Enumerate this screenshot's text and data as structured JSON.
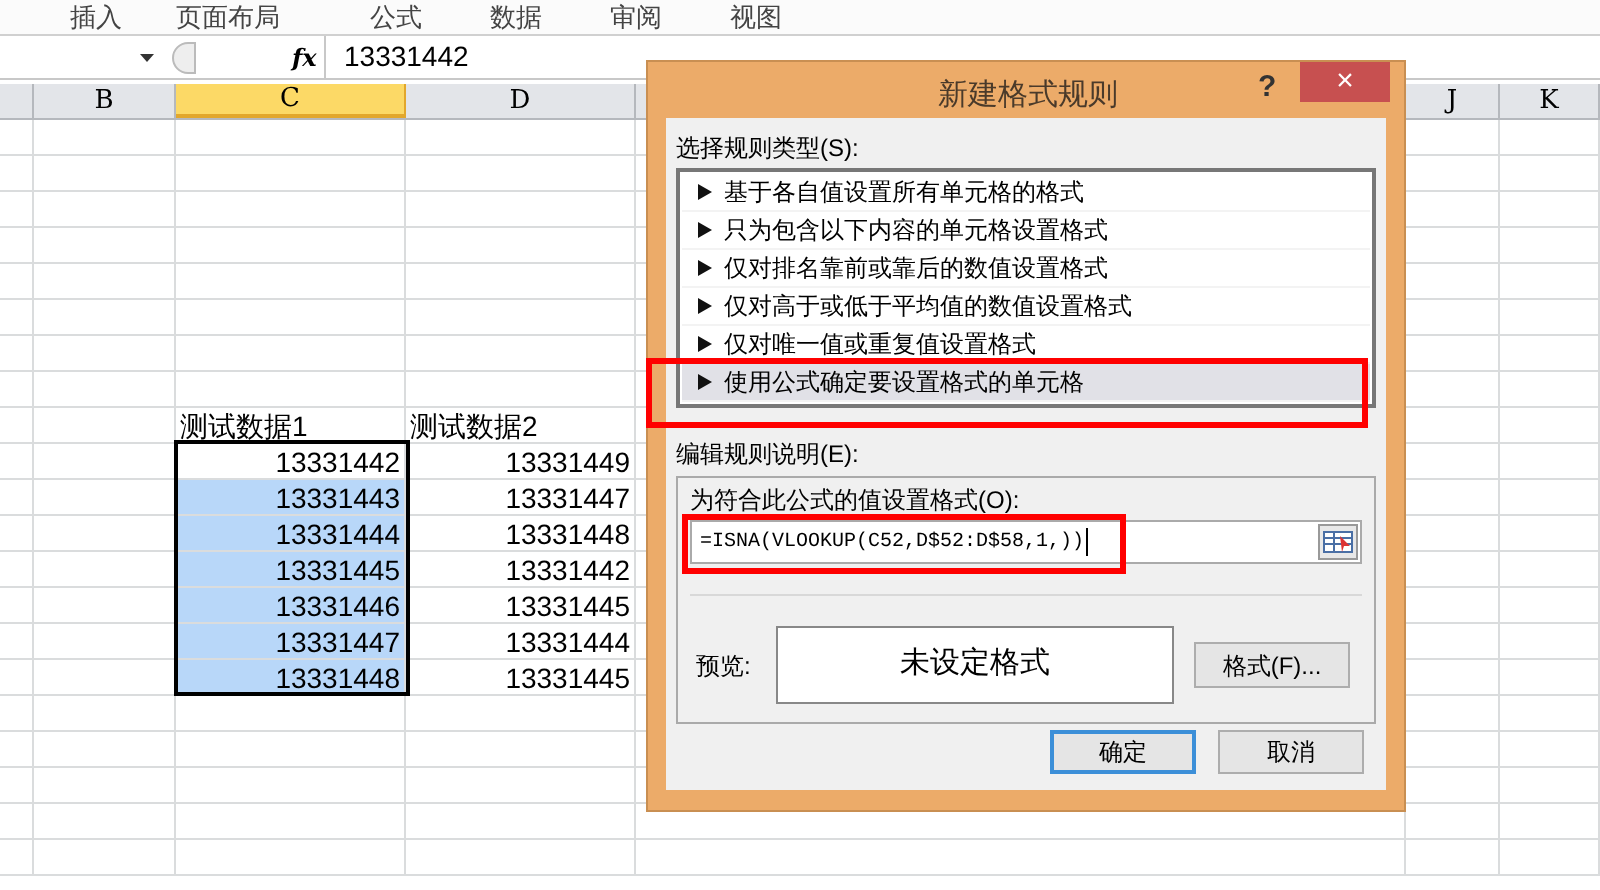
{
  "ribbon_tabs": [
    "插入",
    "页面布局",
    "公式",
    "数据",
    "审阅",
    "视图"
  ],
  "formula_bar": {
    "fx": "fx",
    "value": "13331442"
  },
  "columns": [
    {
      "label": "B",
      "selected": false
    },
    {
      "label": "C",
      "selected": true
    },
    {
      "label": "D",
      "selected": false
    },
    {
      "label": "J",
      "selected": false
    },
    {
      "label": "K",
      "selected": false
    }
  ],
  "cells": [
    {
      "c": "测试数据1",
      "d": "测试数据2",
      "kind": "header"
    },
    {
      "c": "13331442",
      "d": "13331449",
      "kind": "number",
      "selected": false
    },
    {
      "c": "13331443",
      "d": "13331447",
      "kind": "number",
      "selected": true
    },
    {
      "c": "13331444",
      "d": "13331448",
      "kind": "number",
      "selected": true
    },
    {
      "c": "13331445",
      "d": "13331442",
      "kind": "number",
      "selected": true
    },
    {
      "c": "13331446",
      "d": "13331445",
      "kind": "number",
      "selected": true
    },
    {
      "c": "13331447",
      "d": "13331444",
      "kind": "number",
      "selected": true
    },
    {
      "c": "13331448",
      "d": "13331445",
      "kind": "number",
      "selected": true
    }
  ],
  "dialog": {
    "title": "新建格式规则",
    "help": "?",
    "close": "×",
    "rule_type_label": "选择规则类型(S):",
    "rule_types": [
      {
        "label": "基于各自值设置所有单元格的格式",
        "selected": false
      },
      {
        "label": "只为包含以下内容的单元格设置格式",
        "selected": false
      },
      {
        "label": "仅对排名靠前或靠后的数值设置格式",
        "selected": false
      },
      {
        "label": "仅对高于或低于平均值的数值设置格式",
        "selected": false
      },
      {
        "label": "仅对唯一值或重复值设置格式",
        "selected": false
      },
      {
        "label": "使用公式确定要设置格式的单元格",
        "selected": true
      }
    ],
    "edit_label": "编辑规则说明(E):",
    "formula_label": "为符合此公式的值设置格式(O):",
    "formula": "=ISNA(VLOOKUP(C52,D$52:D$58,1,))",
    "preview_label": "预览:",
    "preview_text": "未设定格式",
    "format_button": "格式(F)...",
    "ok": "确定",
    "cancel": "取消"
  }
}
